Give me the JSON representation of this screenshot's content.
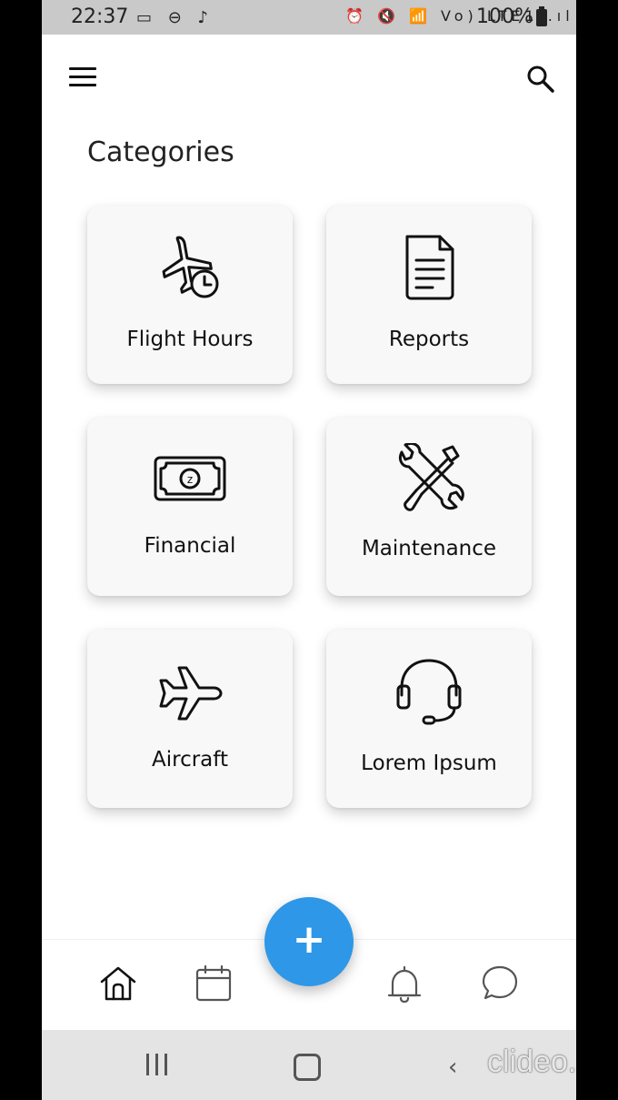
{
  "status_bar": {
    "time": "22:37",
    "left_icons": "▭ ⊖ ♪",
    "right_icons": "⏰ 🔇 📶 Vo) LTE1 .ıl",
    "battery": "100%"
  },
  "header": {
    "menu_icon": "hamburger-menu-icon",
    "search_icon": "search-icon"
  },
  "page": {
    "title": "Categories"
  },
  "categories": [
    {
      "label": "Flight Hours",
      "icon": "plane-clock-icon"
    },
    {
      "label": "Reports",
      "icon": "document-icon"
    },
    {
      "label": "Financial",
      "icon": "money-bill-icon"
    },
    {
      "label": "Maintenance",
      "icon": "wrench-screwdriver-icon"
    },
    {
      "label": "Aircraft",
      "icon": "airplane-icon"
    },
    {
      "label": "Lorem Ipsum",
      "icon": "headset-icon"
    }
  ],
  "fab": {
    "label": "+",
    "color": "#2e97e8"
  },
  "bottom_nav": [
    "home-icon",
    "calendar-icon",
    "bell-icon",
    "chat-icon"
  ],
  "system_nav": [
    "recents-icon",
    "home-button-icon",
    "back-icon"
  ],
  "watermark": "clideo.com"
}
